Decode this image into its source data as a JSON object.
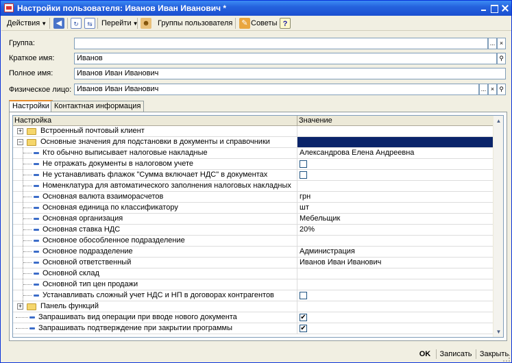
{
  "window": {
    "title": "Настройки пользователя: Иванов Иван Иванович *"
  },
  "toolbar": {
    "actions_label": "Действия",
    "goto_label": "Перейти",
    "groups_label": "Группы пользователя",
    "tips_label": "Советы",
    "help_label": "?"
  },
  "form": {
    "group": {
      "label": "Группа:",
      "value": ""
    },
    "short_name": {
      "label": "Краткое имя:",
      "value": "Иванов"
    },
    "full_name": {
      "label": "Полное имя:",
      "value": "Иванов Иван Иванович"
    },
    "person": {
      "label": "Физическое лицо:",
      "value": "Иванов Иван Иванович"
    },
    "select_button": "...",
    "clear_button": "×",
    "search_glyph": "⚲"
  },
  "tabs": [
    {
      "label": "Настройки",
      "active": true
    },
    {
      "label": "Контактная информация",
      "active": false
    }
  ],
  "grid": {
    "col_setting": "Настройка",
    "col_value": "Значение",
    "rows": [
      {
        "name": "Встроенный почтовый клиент",
        "value": ""
      },
      {
        "name": "Основные значения для подстановки в документы и справочники",
        "value": ""
      },
      {
        "name": "Кто обычно выписывает налоговые накладные",
        "value": "Александрова Елена Андреевна"
      },
      {
        "name": "Не отражать документы в налоговом учете",
        "value": ""
      },
      {
        "name": "Не устанавливать флажок \"Сумма включает НДС\" в документах",
        "value": ""
      },
      {
        "name": "Номенклатура для автоматического заполнения налоговых накладных",
        "value": ""
      },
      {
        "name": "Основная валюта взаиморасчетов",
        "value": "грн"
      },
      {
        "name": "Основная единица по классификатору",
        "value": "шт"
      },
      {
        "name": "Основная организация",
        "value": "Мебельщик"
      },
      {
        "name": "Основная ставка НДС",
        "value": "20%"
      },
      {
        "name": "Основное обособленное подразделение",
        "value": ""
      },
      {
        "name": "Основное подразделение",
        "value": "Администрация"
      },
      {
        "name": "Основной ответственный",
        "value": "Иванов Иван Иванович"
      },
      {
        "name": "Основной склад",
        "value": ""
      },
      {
        "name": "Основной тип цен продажи",
        "value": ""
      },
      {
        "name": "Устанавливать сложный учет НДС и НП в договорах контрагентов",
        "value": ""
      },
      {
        "name": "Панель функций",
        "value": ""
      },
      {
        "name": "Запрашивать вид операции при вводе нового документа",
        "value": ""
      },
      {
        "name": "Запрашивать подтверждение при закрытии программы",
        "value": ""
      }
    ],
    "checkmark": "✔"
  },
  "buttons": {
    "ok": "OK",
    "save": "Записать",
    "close": "Закрыть"
  },
  "colors": {
    "title_bar": "#2563de",
    "selection": "#0a246a",
    "tab_highlight": "#e68b2c"
  }
}
